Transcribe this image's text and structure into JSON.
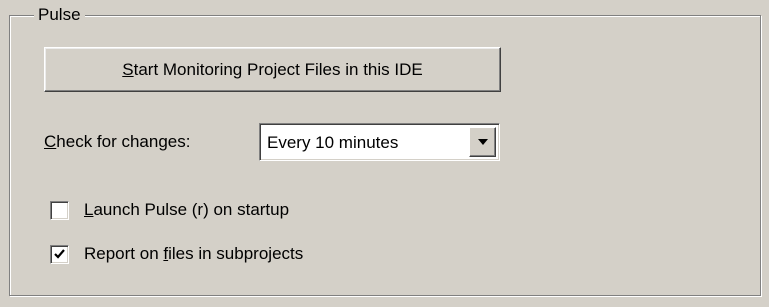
{
  "group": {
    "title": "Pulse"
  },
  "monitor_button": {
    "accel": "S",
    "rest": "tart Monitoring Project Files in this IDE"
  },
  "check_changes": {
    "label_accel": "C",
    "label_rest": "heck for changes:",
    "selected": "Every 10 minutes",
    "arrow_icon": "dropdown-arrow-icon"
  },
  "options": {
    "launch_on_startup": {
      "accel": "L",
      "rest": "aunch Pulse (r) on startup",
      "checked": false
    },
    "report_subprojects": {
      "prefix": "Report on ",
      "accel": "f",
      "rest": "iles in subprojects",
      "checked": true
    }
  }
}
